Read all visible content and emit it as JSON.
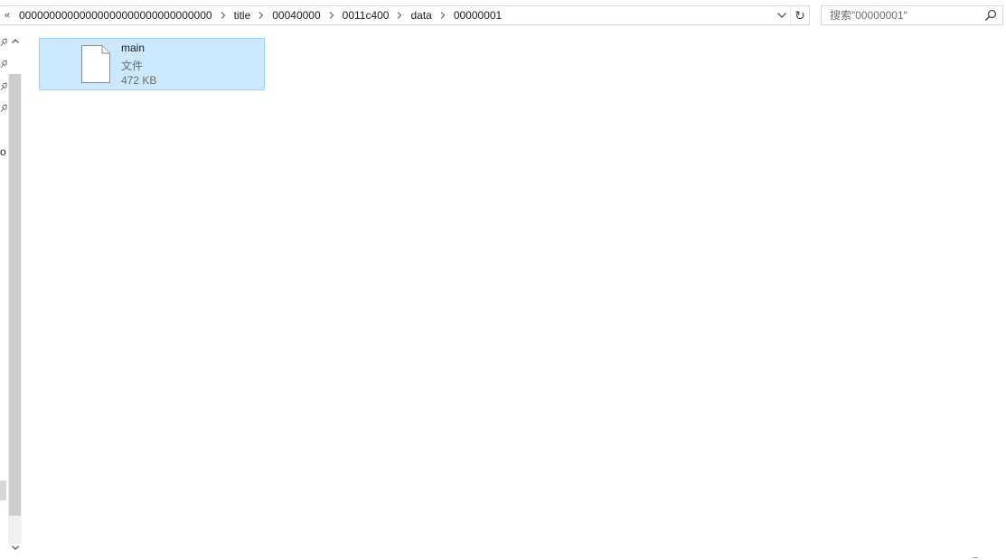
{
  "address_bar": {
    "overflow_glyph": "«",
    "breadcrumbs": [
      "00000000000000000000000000000000",
      "title",
      "00040000",
      "0011c400",
      "data",
      "00000001"
    ],
    "refresh_glyph": "↻"
  },
  "search": {
    "placeholder": "搜索\"00000001\""
  },
  "navigation_pane": {
    "partial_label": "o"
  },
  "files": [
    {
      "name": "main",
      "type": "文件",
      "size": "472 KB"
    }
  ],
  "colors": {
    "selection_fill": "#cce8ff",
    "selection_border": "#99d1ff",
    "secondary_text": "#6d6d6d"
  }
}
